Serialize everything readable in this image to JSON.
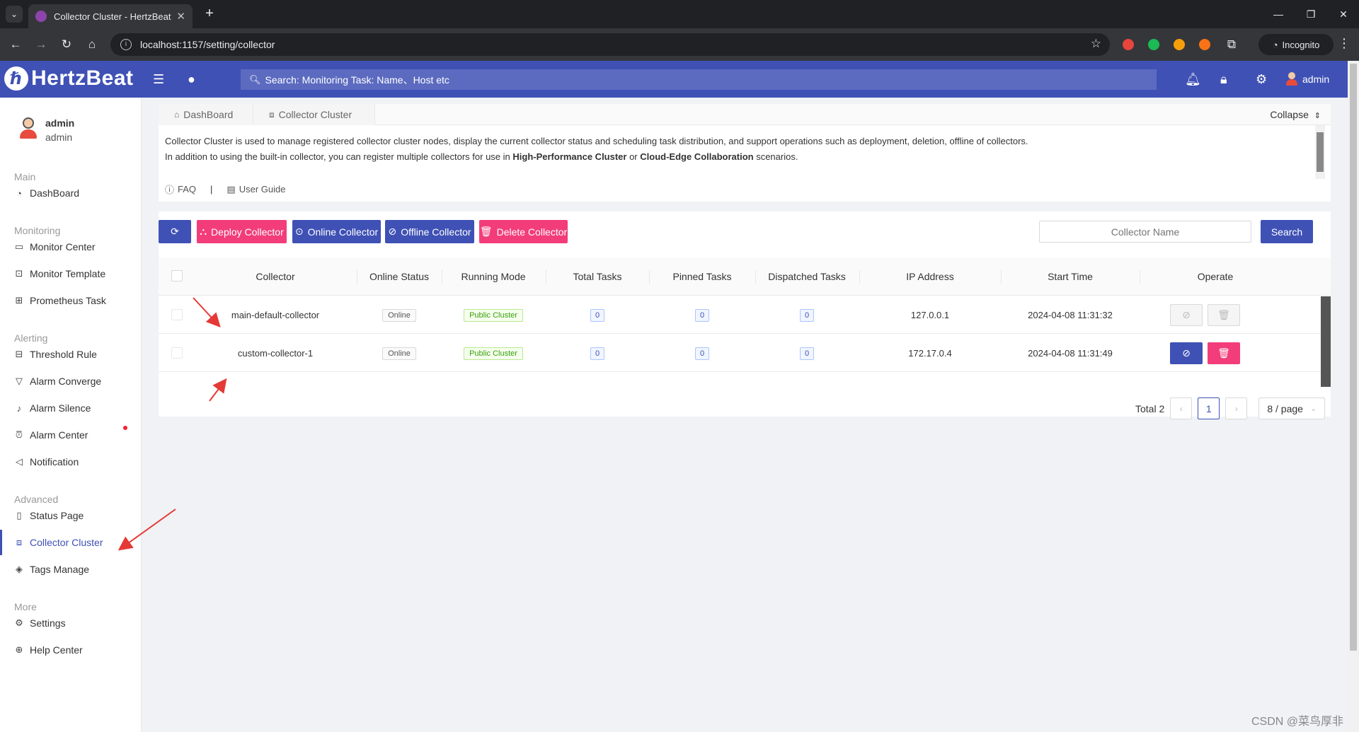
{
  "browser": {
    "tab_title": "Collector Cluster - HertzBeat",
    "url": "localhost:1157/setting/collector",
    "incognito_label": "Incognito"
  },
  "header": {
    "logo_text": "HertzBeat",
    "search_text": "Search:  Monitoring Task: Name、Host etc",
    "user_label": "admin"
  },
  "sidebar": {
    "user_name": "admin",
    "user_role": "admin",
    "groups": {
      "main": "Main",
      "monitoring": "Monitoring",
      "alerting": "Alerting",
      "advanced": "Advanced",
      "more": "More"
    },
    "items": {
      "dashboard": "DashBoard",
      "monitor_center": "Monitor Center",
      "monitor_template": "Monitor Template",
      "prometheus_task": "Prometheus Task",
      "threshold_rule": "Threshold Rule",
      "alarm_converge": "Alarm Converge",
      "alarm_silence": "Alarm Silence",
      "alarm_center": "Alarm Center",
      "notification": "Notification",
      "status_page": "Status Page",
      "collector_cluster": "Collector Cluster",
      "tags_manage": "Tags Manage",
      "settings": "Settings",
      "help_center": "Help Center"
    }
  },
  "content": {
    "tabs": {
      "dashboard": "DashBoard",
      "collector_cluster": "Collector Cluster"
    },
    "collapse_label": "Collapse",
    "description": {
      "line1": "Collector Cluster is used to manage registered collector cluster nodes, display the current collector status and scheduling task distribution, and support operations such as deployment, deletion, offline of collectors.",
      "line2_prefix": "In addition to using the built-in collector, you can register multiple collectors for use in ",
      "line2_bold1": "High-Performance Cluster",
      "line2_mid": " or ",
      "line2_bold2": "Cloud-Edge Collaboration",
      "line2_suffix": " scenarios.",
      "faq": "FAQ",
      "separator": "|",
      "user_guide": "User Guide"
    },
    "toolbar": {
      "deploy": "Deploy Collector",
      "online": "Online Collector",
      "offline": "Offline Collector",
      "delete": "Delete Collector",
      "filter_placeholder": "Collector Name",
      "search": "Search"
    },
    "table": {
      "columns": {
        "collector": "Collector",
        "online_status": "Online Status",
        "running_mode": "Running Mode",
        "total_tasks": "Total Tasks",
        "pinned_tasks": "Pinned Tasks",
        "dispatched_tasks": "Dispatched Tasks",
        "ip": "IP Address",
        "start_time": "Start Time",
        "operate": "Operate"
      },
      "rows": [
        {
          "collector": "main-default-collector",
          "status": "Online",
          "mode": "Public Cluster",
          "total": "0",
          "pinned": "0",
          "dispatched": "0",
          "ip": "127.0.0.1",
          "start": "2024-04-08 11:31:32"
        },
        {
          "collector": "custom-collector-1",
          "status": "Online",
          "mode": "Public Cluster",
          "total": "0",
          "pinned": "0",
          "dispatched": "0",
          "ip": "172.17.0.4",
          "start": "2024-04-08 11:31:49"
        }
      ]
    },
    "pagination": {
      "total": "Total 2",
      "current": "1",
      "page_size": "8 / page"
    }
  },
  "watermark": "CSDN @菜鸟厚非",
  "colors": {
    "primary": "#3f51b5",
    "danger": "#f23d7a",
    "annotation_arrow": "#e53935"
  }
}
